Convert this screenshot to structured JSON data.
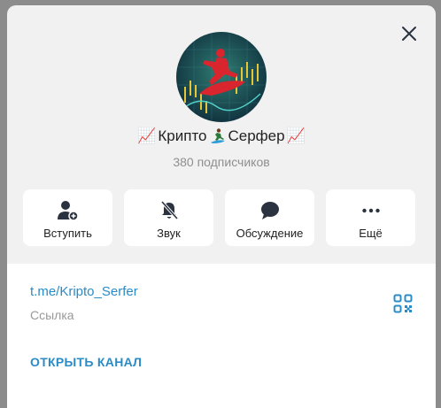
{
  "channel": {
    "title_left_emoji": "📈",
    "title_part1": "Крипто",
    "title_part2": "Серфер",
    "title_right_emoji": "📈",
    "subscribers": "380 подписчиков"
  },
  "actions": [
    {
      "label": "Вступить",
      "icon": "add-user-icon"
    },
    {
      "label": "Звук",
      "icon": "bell-muted-icon"
    },
    {
      "label": "Обсуждение",
      "icon": "chat-bubble-icon"
    },
    {
      "label": "Ещё",
      "icon": "more-dots-icon"
    }
  ],
  "info": {
    "link": "t.me/Kripto_Serfer",
    "link_label": "Ссылка",
    "open_channel": "ОТКРЫТЬ КАНАЛ"
  },
  "colors": {
    "accent": "#2a8bc6",
    "icon": "#2b3340",
    "muted": "#8f8f8f"
  }
}
